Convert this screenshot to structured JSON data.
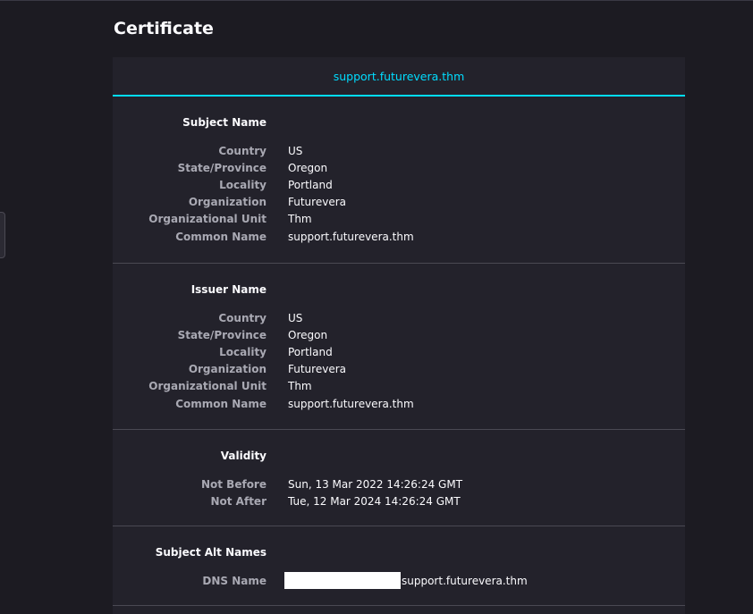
{
  "page": {
    "title": "Certificate",
    "tab_label": "support.futurevera.thm"
  },
  "subject": {
    "heading": "Subject Name",
    "rows": [
      {
        "label": "Country",
        "value": "US"
      },
      {
        "label": "State/Province",
        "value": "Oregon"
      },
      {
        "label": "Locality",
        "value": "Portland"
      },
      {
        "label": "Organization",
        "value": "Futurevera"
      },
      {
        "label": "Organizational Unit",
        "value": "Thm"
      },
      {
        "label": "Common Name",
        "value": "support.futurevera.thm"
      }
    ]
  },
  "issuer": {
    "heading": "Issuer Name",
    "rows": [
      {
        "label": "Country",
        "value": "US"
      },
      {
        "label": "State/Province",
        "value": "Oregon"
      },
      {
        "label": "Locality",
        "value": "Portland"
      },
      {
        "label": "Organization",
        "value": "Futurevera"
      },
      {
        "label": "Organizational Unit",
        "value": "Thm"
      },
      {
        "label": "Common Name",
        "value": "support.futurevera.thm"
      }
    ]
  },
  "validity": {
    "heading": "Validity",
    "rows": [
      {
        "label": "Not Before",
        "value": "Sun, 13 Mar 2022 14:26:24 GMT"
      },
      {
        "label": "Not After",
        "value": "Tue, 12 Mar 2024 14:26:24 GMT"
      }
    ]
  },
  "alt_names": {
    "heading": "Subject Alt Names",
    "rows": [
      {
        "label": "DNS Name",
        "value": "support.futurevera.thm"
      }
    ]
  },
  "colors": {
    "accent": "#00ddff",
    "background": "#1c1b22",
    "card": "#23222b"
  }
}
